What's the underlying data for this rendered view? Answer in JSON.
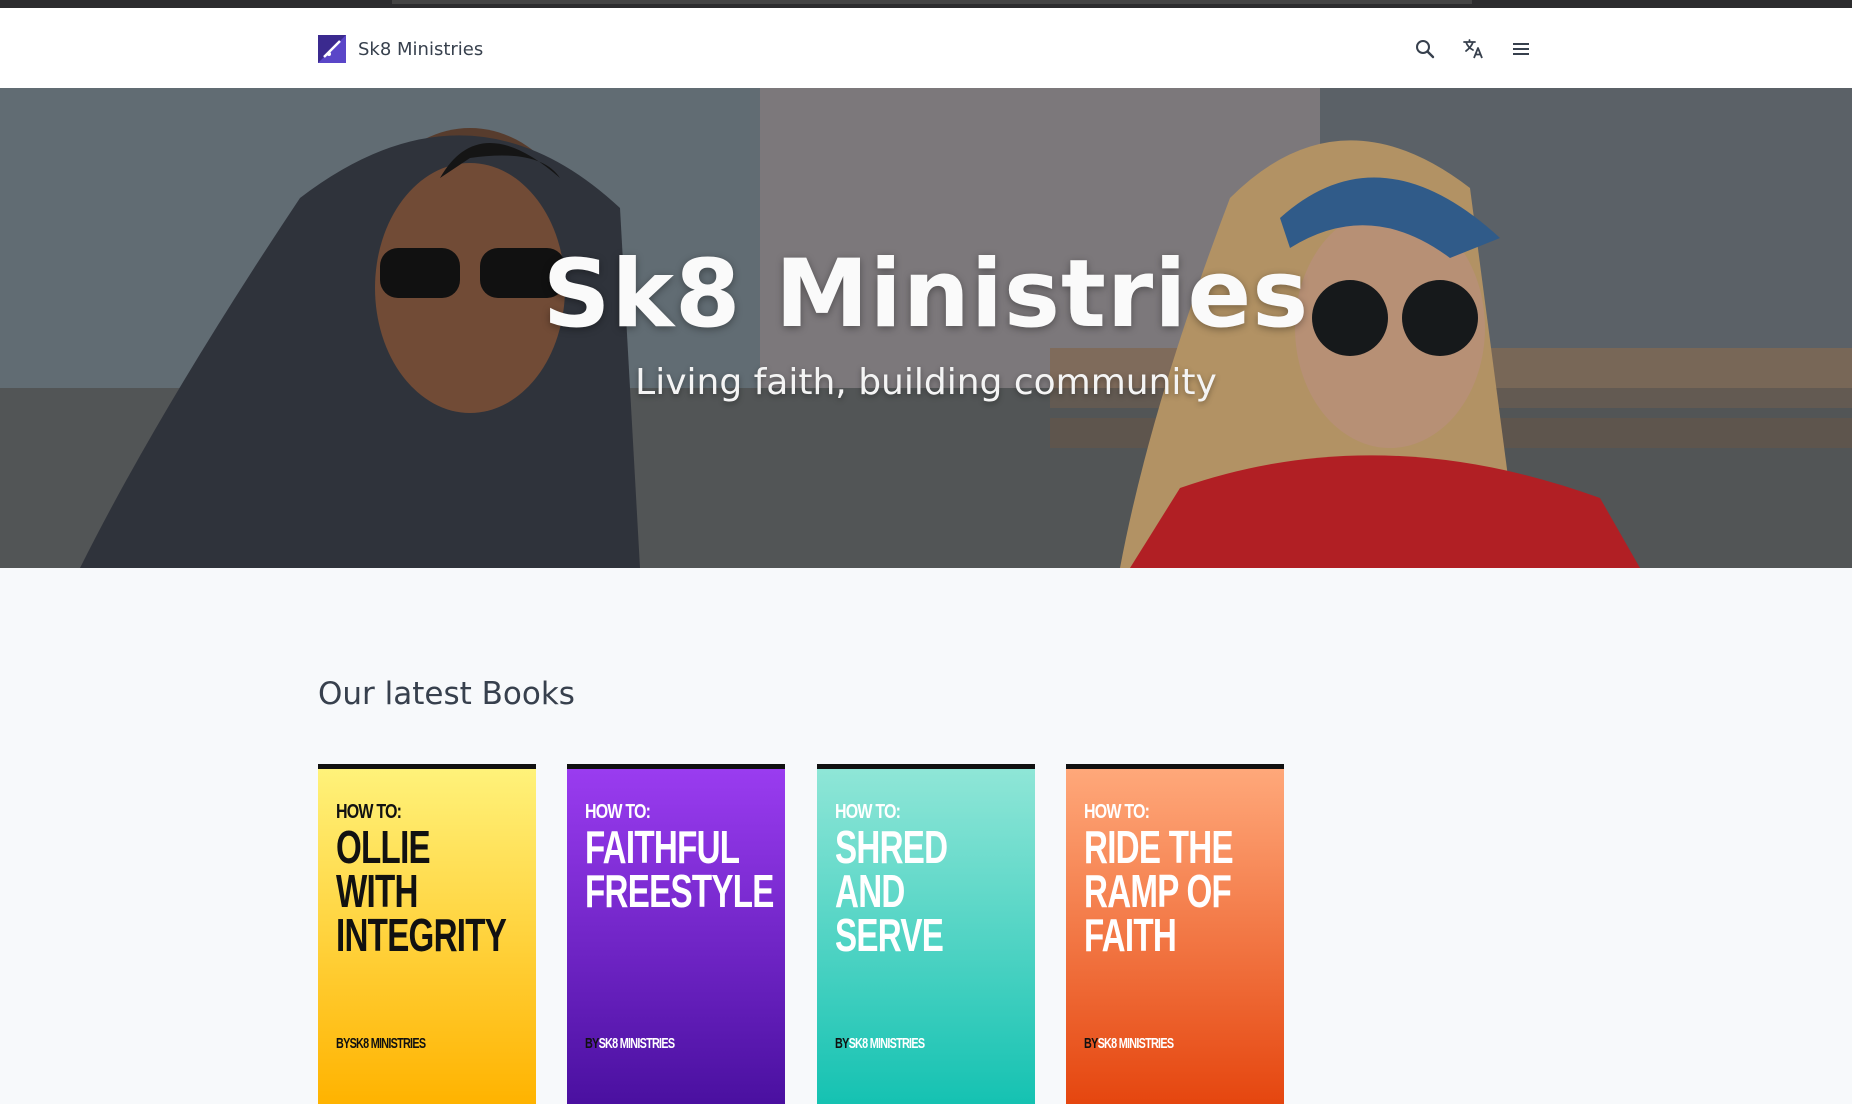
{
  "brand": {
    "name": "Sk8 Ministries",
    "accent": "#3b2a8f"
  },
  "nav": {
    "icons": [
      "search-icon",
      "translate-icon",
      "menu-icon"
    ]
  },
  "hero": {
    "title": "Sk8 Ministries",
    "subtitle": "Living faith, building community"
  },
  "books_section": {
    "title": "Our latest Books",
    "books": [
      {
        "howto": "HOW TO:",
        "title_line1": "OLLIE WITH",
        "title_line2": "INTEGRITY",
        "title_line3": "",
        "by": "BY",
        "publisher": "SK8 MINISTRIES",
        "text_color": "#111111",
        "colors": [
          "#fff27a",
          "#ffb300"
        ]
      },
      {
        "howto": "HOW TO:",
        "title_line1": "FAITHFUL",
        "title_line2": "FREESTYLE",
        "title_line3": "",
        "by": "BY",
        "publisher": "SK8 MINISTRIES",
        "text_color": "#ffffff",
        "colors": [
          "#9a3cf0",
          "#4a10a0"
        ]
      },
      {
        "howto": "HOW TO:",
        "title_line1": "SHRED AND",
        "title_line2": "SERVE",
        "title_line3": "",
        "by": "BY",
        "publisher": "SK8 MINISTRIES",
        "text_color": "#ffffff",
        "colors": [
          "#8fe6d7",
          "#15c2b2"
        ]
      },
      {
        "howto": "HOW TO:",
        "title_line1": "RIDE THE",
        "title_line2": "RAMP OF",
        "title_line3": "FAITH",
        "by": "BY",
        "publisher": "SK8 MINISTRIES",
        "text_color": "#ffffff",
        "colors": [
          "#ffa87a",
          "#e5460f"
        ]
      }
    ]
  }
}
